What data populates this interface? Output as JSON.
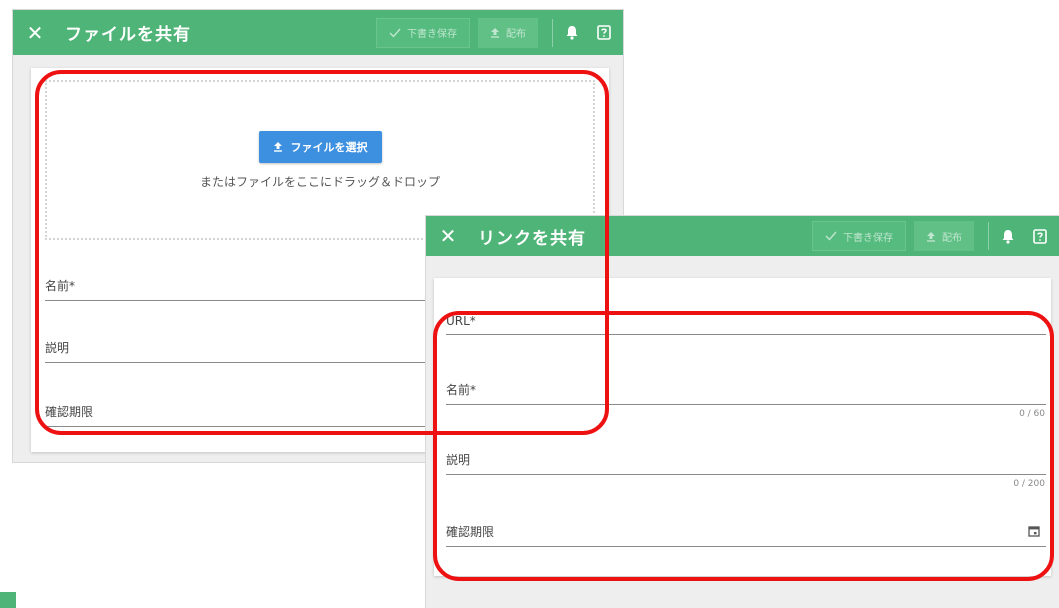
{
  "file_dialog": {
    "title": "ファイルを共有",
    "draft_button": "下書き保存",
    "publish_button": "配布",
    "upload_button": "ファイルを選択",
    "drop_hint": "またはファイルをここにドラッグ＆ドロップ",
    "name_label": "名前*",
    "description_label": "説明",
    "deadline_label": "確認期限"
  },
  "link_dialog": {
    "title": "リンクを共有",
    "draft_button": "下書き保存",
    "publish_button": "配布",
    "url_label": "URL*",
    "name_label": "名前*",
    "name_counter": "0 / 60",
    "description_label": "説明",
    "description_counter": "0 / 200",
    "deadline_label": "確認期限"
  },
  "icons": {
    "close": "close-icon",
    "check": "check-icon",
    "upload": "upload-icon",
    "bell": "bell-icon",
    "help": "help-icon",
    "calendar": "calendar-icon"
  },
  "colors": {
    "header_green": "#4fb477",
    "upload_blue": "#3d8fe0",
    "highlight_red": "#ee1111"
  }
}
